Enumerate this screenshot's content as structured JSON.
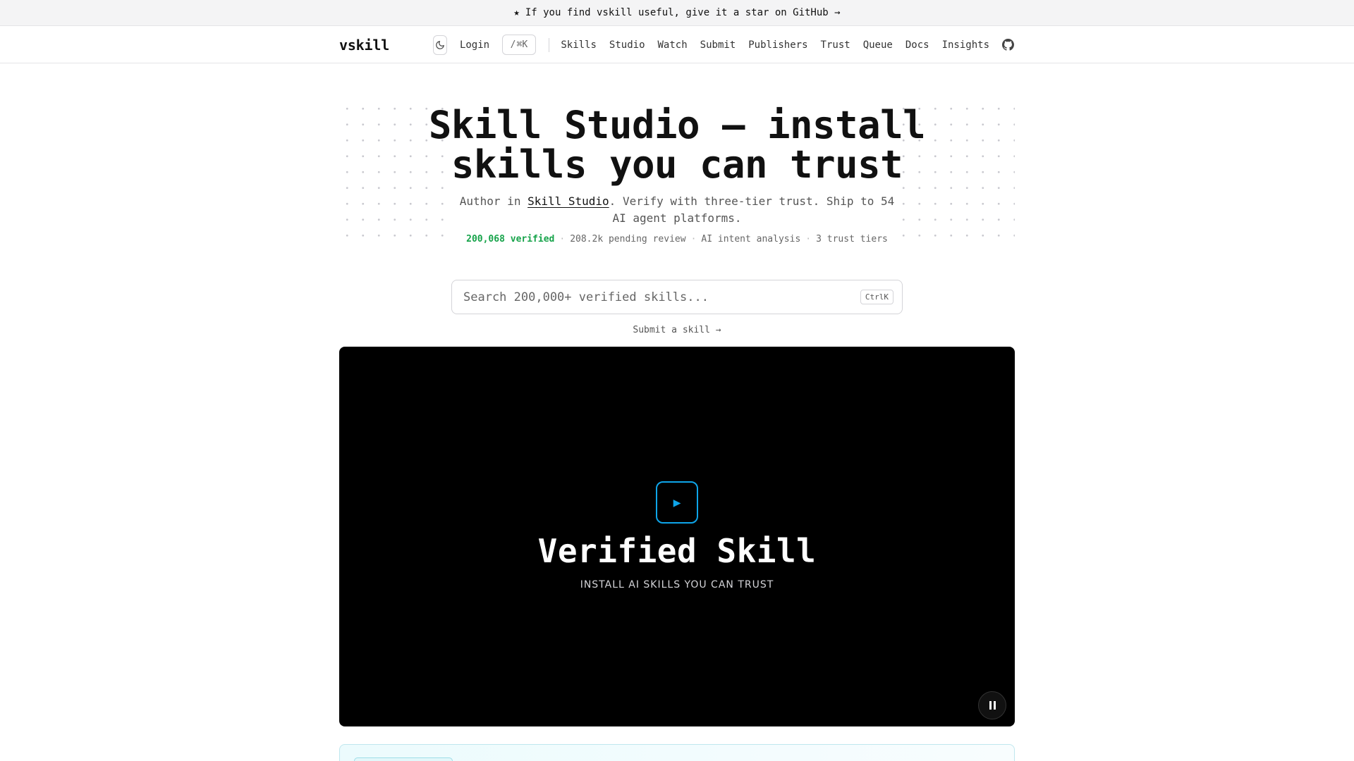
{
  "banner": {
    "text": "If you find vskill useful, give it a star on GitHub →",
    "star_icon": "star-icon"
  },
  "nav": {
    "logo": "vskill",
    "login": "Login",
    "search_shortcut_slash": "/",
    "search_shortcut_keys": "⌘K",
    "links": [
      "Skills",
      "Studio",
      "Watch",
      "Submit",
      "Publishers",
      "Trust",
      "Queue",
      "Docs",
      "Insights"
    ]
  },
  "hero": {
    "title": "Skill Studio — install skills you can trust",
    "sub_prefix": "Author in ",
    "sub_link": "Skill Studio",
    "sub_suffix": ". Verify with three-tier trust. Ship to 54 AI agent platforms.",
    "stats": {
      "verified": "200,068 verified",
      "pending": "208.2k pending review",
      "analysis": "AI intent analysis",
      "tiers": "3 trust tiers"
    }
  },
  "search": {
    "placeholder": "Search 200,000+ verified skills...",
    "value": "",
    "shortcut": "CtrlK"
  },
  "submit_link": "Submit a skill →",
  "video": {
    "title": "Verified Skill",
    "tagline": "INSTALL AI SKILLS YOU CAN TRUST",
    "accent": "#0ea5e9"
  },
  "colors": {
    "verified_green": "#16a34a",
    "video_bg": "#000000"
  }
}
